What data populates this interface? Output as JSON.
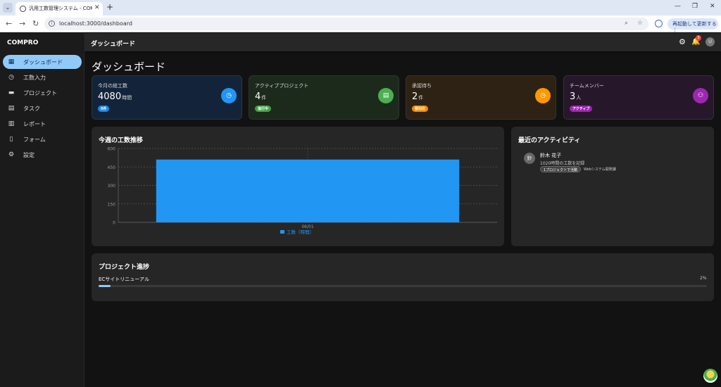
{
  "browser": {
    "tab_title": "汎用工数管理システム - COMPRO",
    "url": "localhost:3000/dashboard",
    "update_button": "再起動して更新する"
  },
  "sidebar": {
    "brand": "COMPRO",
    "items": [
      {
        "label": "ダッシュボード",
        "icon": "dashboard-icon",
        "active": true
      },
      {
        "label": "工数入力",
        "icon": "clock-icon",
        "active": false
      },
      {
        "label": "プロジェクト",
        "icon": "folder-icon",
        "active": false
      },
      {
        "label": "タスク",
        "icon": "clipboard-icon",
        "active": false
      },
      {
        "label": "レポート",
        "icon": "chart-icon",
        "active": false
      },
      {
        "label": "フォーム",
        "icon": "document-icon",
        "active": false
      },
      {
        "label": "設定",
        "icon": "gear-icon",
        "active": false
      }
    ]
  },
  "appbar": {
    "title": "ダッシュボード",
    "notification_count": "3",
    "user_initial": "U"
  },
  "page": {
    "title": "ダッシュボード"
  },
  "stats": [
    {
      "label": "今月の総工数",
      "value": "4080",
      "unit": "時間",
      "chip": "0件",
      "chip_color": "#1e88e5",
      "icon_color": "#2196f3",
      "bg": "#13243a",
      "icon": "clock-icon"
    },
    {
      "label": "アクティブプロジェクト",
      "value": "4",
      "unit": "件",
      "chip": "進行中",
      "chip_color": "#43a047",
      "icon_color": "#4caf50",
      "bg": "#1c2a1c",
      "icon": "clipboard-icon"
    },
    {
      "label": "承認待ち",
      "value": "2",
      "unit": "件",
      "chip": "要対応",
      "chip_color": "#ef8c00",
      "icon_color": "#ff9800",
      "bg": "#2e2214",
      "icon": "clock-icon"
    },
    {
      "label": "チームメンバー",
      "value": "3",
      "unit": "人",
      "chip": "アクティブ",
      "chip_color": "#9c27b0",
      "icon_color": "#9c27b0",
      "bg": "#27172b",
      "icon": "group-icon"
    }
  ],
  "weekly_chart": {
    "title": "今週の工数推移"
  },
  "chart_data": {
    "type": "bar",
    "categories": [
      "06/01"
    ],
    "series": [
      {
        "name": "工数（時間）",
        "values": [
          510
        ],
        "color": "#2196f3"
      }
    ],
    "ylim": [
      0,
      600
    ],
    "yticks": [
      "0",
      "150",
      "300",
      "450",
      "600"
    ],
    "grid": true,
    "legend": "bottom"
  },
  "activity": {
    "title": "最近のアクティビティ",
    "items": [
      {
        "avatar": "鈴",
        "name": "鈴木 花子",
        "desc": "1020時間の工数を記録",
        "chip": "1プロジェクトで活動",
        "project": "Webシステム開発課"
      }
    ]
  },
  "progress": {
    "title": "プロジェクト進捗",
    "items": [
      {
        "name": "ECサイトリニューアル",
        "percent": 2,
        "percent_label": "2%"
      }
    ]
  }
}
